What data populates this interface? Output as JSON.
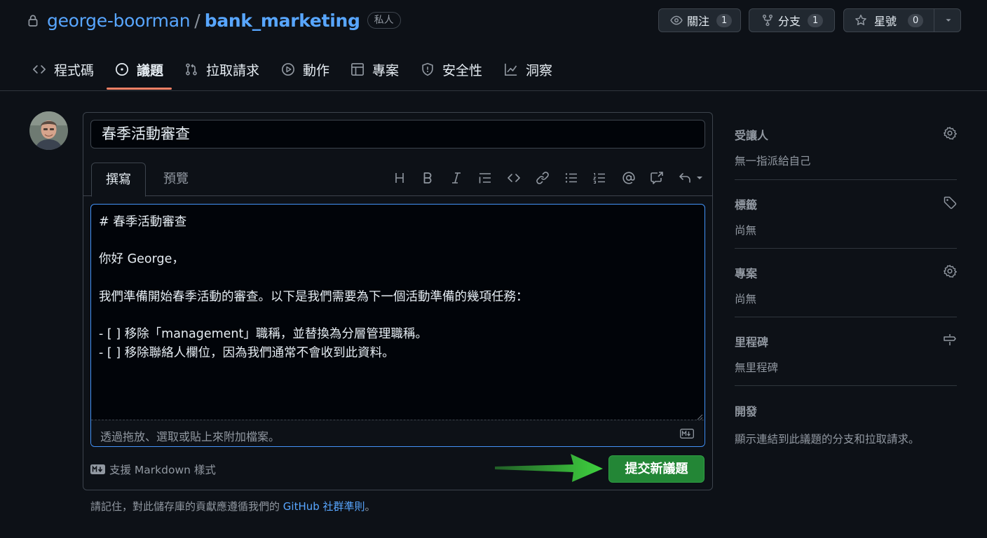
{
  "repo": {
    "owner": "george-boorman",
    "separator": "/",
    "name": "bank_marketing",
    "visibility": "私人"
  },
  "header_buttons": {
    "watch_label": "關注",
    "watch_count": "1",
    "fork_label": "分支",
    "fork_count": "1",
    "star_label": "星號",
    "star_count": "0"
  },
  "tabs": [
    {
      "label": "程式碼",
      "icon": "code-icon"
    },
    {
      "label": "議題",
      "icon": "issue-opened-icon",
      "active": true
    },
    {
      "label": "拉取請求",
      "icon": "git-pull-request-icon"
    },
    {
      "label": "動作",
      "icon": "play-icon"
    },
    {
      "label": "專案",
      "icon": "table-icon"
    },
    {
      "label": "安全性",
      "icon": "shield-icon"
    },
    {
      "label": "洞察",
      "icon": "graph-icon"
    }
  ],
  "issue_form": {
    "title_value": "春季活動審查",
    "write_tab": "撰寫",
    "preview_tab": "預覽",
    "toolbar_icons": [
      "heading-icon",
      "bold-icon",
      "italic-icon",
      "quote-icon",
      "code-icon",
      "link-icon",
      "unordered-list-icon",
      "ordered-list-icon",
      "mention-icon",
      "cross-reference-icon",
      "reply-icon"
    ],
    "body_lines": [
      "# 春季活動審查",
      "",
      "你好 George，",
      "",
      "我們準備開始春季活動的審查。以下是我們需要為下一個活動準備的幾項任務：",
      "",
      "- [ ] 移除「management」職稱，並替換為分層管理職稱。",
      "- [ ] 移除聯絡人欄位，因為我們通常不會收到此資料。"
    ],
    "attach_hint": "透過拖放、選取或貼上來附加檔案。",
    "markdown_support": "支援 Markdown 樣式",
    "submit_label": "提交新議題",
    "footer_text": "請記住，對此儲存庫的貢獻應遵循我們的 ",
    "footer_link": "GitHub 社群準則",
    "footer_end": "。"
  },
  "sidebar": {
    "assignees": {
      "heading": "受讓人",
      "value": "無一指派給自己"
    },
    "labels": {
      "heading": "標籤",
      "value": "尚無"
    },
    "projects": {
      "heading": "專案",
      "value": "尚無"
    },
    "milestone": {
      "heading": "里程碑",
      "value": "無里程碑"
    },
    "development": {
      "heading": "開發",
      "value": "顯示連結到此議題的分支和拉取請求。"
    }
  },
  "colors": {
    "background": "#0d1117",
    "link": "#58a6ff",
    "active_tab_underline": "#f78166",
    "submit_button": "#238636",
    "focus_border": "#4493f8",
    "annotation_arrow": "#3fd23f"
  }
}
